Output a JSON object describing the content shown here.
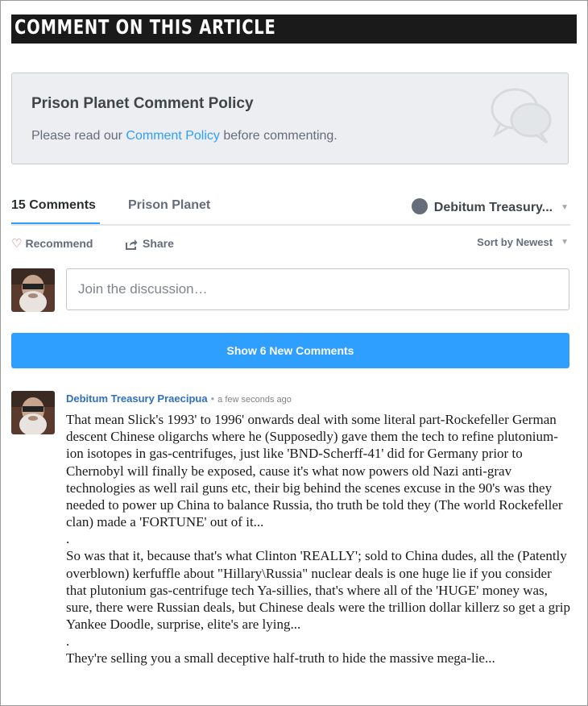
{
  "header": {
    "title": "COMMENT ON THIS ARTICLE"
  },
  "policy": {
    "title": "Prison Planet Comment Policy",
    "text_before": "Please read our ",
    "link": "Comment Policy",
    "text_after": " before commenting."
  },
  "tabs": {
    "comments": "15 Comments",
    "community": "Prison Planet",
    "user": "Debitum Treasury..."
  },
  "actions": {
    "recommend": "Recommend",
    "share": "Share",
    "sort": "Sort by Newest"
  },
  "composer": {
    "placeholder": "Join the discussion…"
  },
  "show_new": "Show 6 New Comments",
  "comment": {
    "author": "Debitum Treasury Praecipua",
    "bullet": "•",
    "time": "a few seconds ago",
    "paragraphs": [
      "That mean Slick's 1993' to 1996' onwards deal with some literal part-Rockefeller German descent Chinese oligarchs where he (Supposedly) gave them the tech to refine plutonium-ion isotopes in gas-centrifuges, just like 'BND-Scherff-41' did for Germany prior to Chernobyl will finally be exposed, cause it's what now powers old Nazi anti-grav technologies as well rail guns etc, their big behind the scenes excuse in the 90's was they needed to power up China to balance Russia, tho truth be told they (The world Rockefeller clan) made a 'FORTUNE' out of it...",
      ".",
      "So was that it, because that's what Clinton 'REALLY'; sold to China dudes, all the (Patently overblown) kerfuffle about \"Hillary\\Russia\" nuclear deals is one huge lie if you consider that plutonium gas-centrifuge tech Ya-sillies, that's where all of the 'HUGE' money was, sure, there were Russian deals, but Chinese deals were the trillion dollar killerz so get a grip Yankee Doodle, surprise, elite's are lying...",
      ".",
      "They're selling you a small deceptive half-truth to hide the massive mega-lie..."
    ]
  },
  "colors": {
    "accent": "#2e9fff",
    "header_bg": "#1a1a1a",
    "author_link": "#2e70bf",
    "heart": "#e0545a"
  },
  "icons": [
    "speech-bubbles-icon",
    "user-dot-icon",
    "heart-icon",
    "share-icon",
    "chevron-down-icon"
  ]
}
